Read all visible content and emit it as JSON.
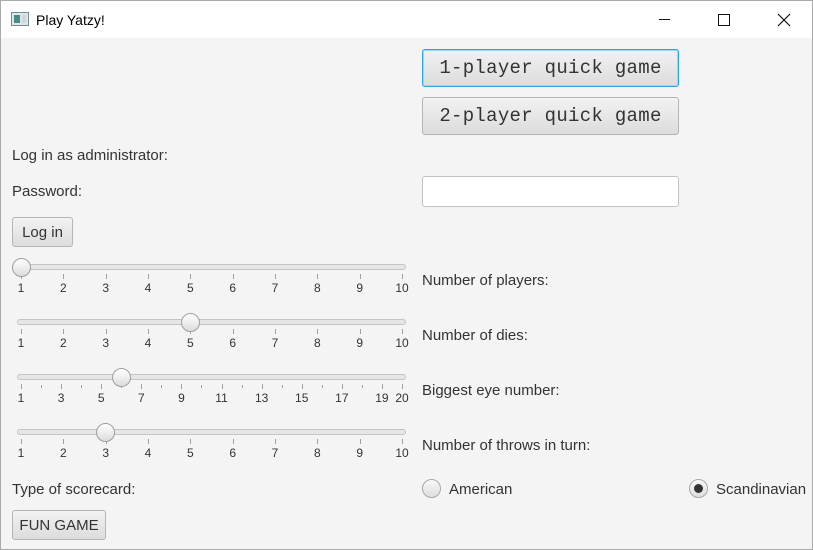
{
  "window": {
    "title": "Play Yatzy!"
  },
  "quick_games": {
    "one_player": "1-player quick game",
    "two_player": "2-player quick game"
  },
  "admin": {
    "heading": "Log in as administrator:",
    "password_label": "Password:",
    "password_value": "",
    "login_button": "Log in"
  },
  "sliders": [
    {
      "label": "Number of players:",
      "min": 1,
      "max": 10,
      "value": 1,
      "major_ticks": [
        1,
        2,
        3,
        4,
        5,
        6,
        7,
        8,
        9,
        10
      ],
      "minor_ticks": [],
      "tick_labels": [
        "1",
        "2",
        "3",
        "4",
        "5",
        "6",
        "7",
        "8",
        "9",
        "10"
      ]
    },
    {
      "label": "Number of dies:",
      "min": 1,
      "max": 10,
      "value": 5,
      "major_ticks": [
        1,
        2,
        3,
        4,
        5,
        6,
        7,
        8,
        9,
        10
      ],
      "minor_ticks": [],
      "tick_labels": [
        "1",
        "2",
        "3",
        "4",
        "5",
        "6",
        "7",
        "8",
        "9",
        "10"
      ]
    },
    {
      "label": "Biggest eye number:",
      "min": 1,
      "max": 20,
      "value": 6,
      "major_ticks": [
        1,
        3,
        5,
        7,
        9,
        11,
        13,
        15,
        17,
        19,
        20
      ],
      "minor_ticks": [
        2,
        4,
        6,
        8,
        10,
        12,
        14,
        16,
        18
      ],
      "tick_labels": [
        "1",
        "3",
        "5",
        "7",
        "9",
        "11",
        "13",
        "15",
        "17",
        "19",
        "20"
      ]
    },
    {
      "label": "Number of throws in turn:",
      "min": 1,
      "max": 10,
      "value": 3,
      "major_ticks": [
        1,
        2,
        3,
        4,
        5,
        6,
        7,
        8,
        9,
        10
      ],
      "minor_ticks": [],
      "tick_labels": [
        "1",
        "2",
        "3",
        "4",
        "5",
        "6",
        "7",
        "8",
        "9",
        "10"
      ]
    }
  ],
  "scorecard": {
    "label": "Type of scorecard:",
    "options": [
      "American",
      "Scandinavian"
    ],
    "selected": "Scandinavian"
  },
  "fun_game_button": "FUN GAME",
  "icons": {
    "app": "yatzy-app-icon",
    "minimize": "minimize-icon",
    "maximize": "maximize-icon",
    "close": "close-icon"
  }
}
